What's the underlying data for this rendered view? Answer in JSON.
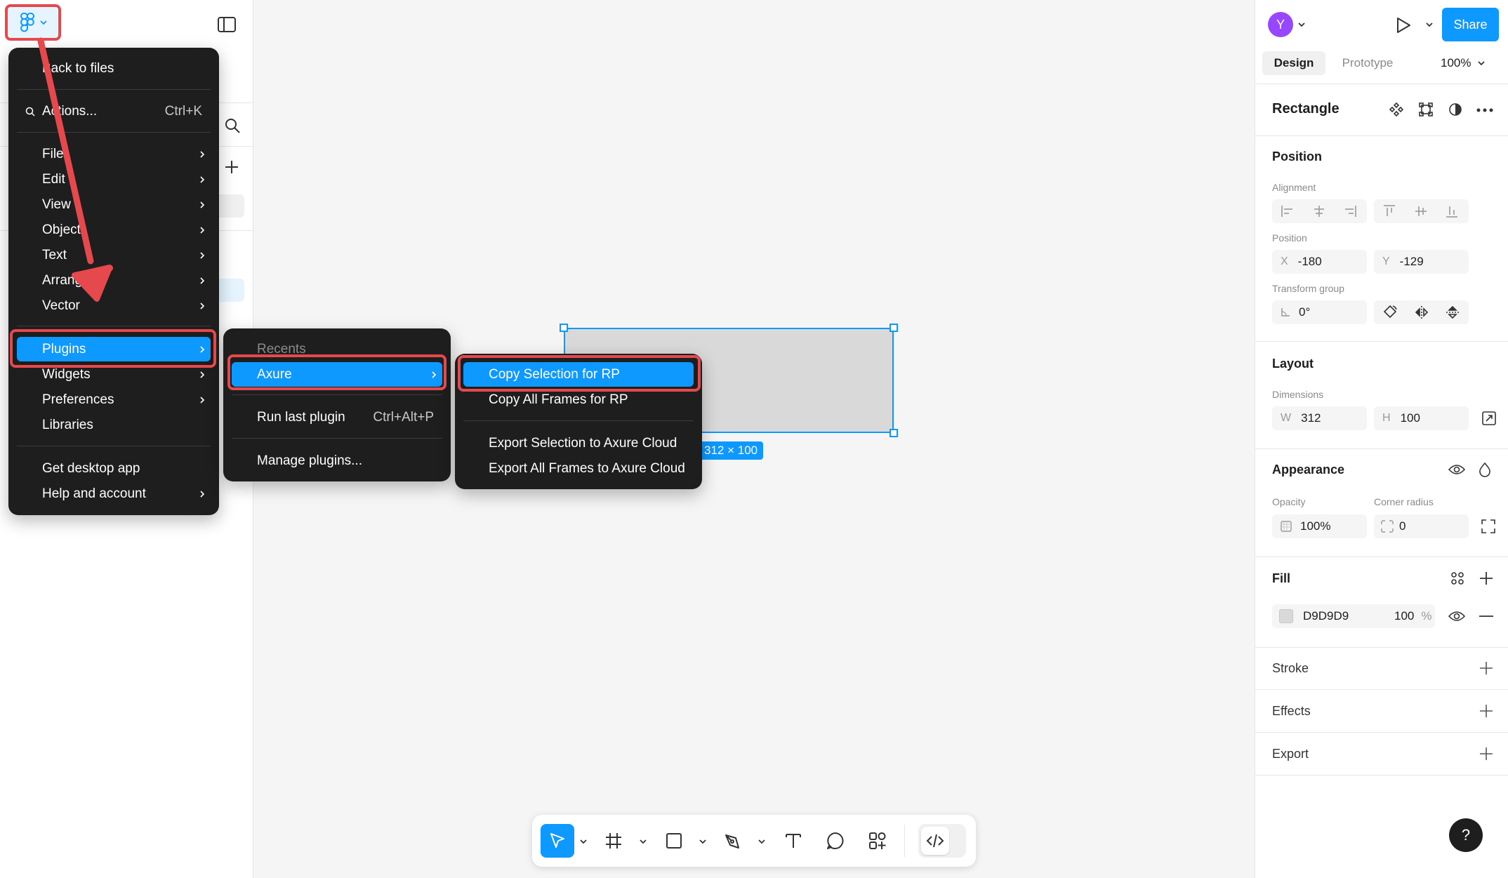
{
  "main_menu": {
    "back": "Back to files",
    "actions": "Actions...",
    "actions_shortcut": "Ctrl+K",
    "items": [
      "File",
      "Edit",
      "View",
      "Object",
      "Text",
      "Arrange",
      "Vector"
    ],
    "plugins": "Plugins",
    "items2": [
      "Widgets",
      "Preferences",
      "Libraries"
    ],
    "desktop": "Get desktop app",
    "help": "Help and account"
  },
  "plugins_menu": {
    "recents": "Recents",
    "axure": "Axure",
    "run_last": "Run last plugin",
    "run_last_shortcut": "Ctrl+Alt+P",
    "manage": "Manage plugins..."
  },
  "axure_menu": {
    "items": [
      "Copy Selection for RP",
      "Copy All Frames for RP",
      "Export Selection to Axure Cloud",
      "Export All Frames to Axure Cloud"
    ]
  },
  "canvas": {
    "size_label": "312 × 100"
  },
  "header": {
    "avatar_initial": "Y",
    "share": "Share",
    "tab_design": "Design",
    "tab_prototype": "Prototype",
    "zoom": "100%"
  },
  "inspector": {
    "layer_name": "Rectangle",
    "position": {
      "title": "Position",
      "alignment_label": "Alignment",
      "position_label": "Position",
      "x_key": "X",
      "x": "-180",
      "y_key": "Y",
      "y": "-129",
      "transform_label": "Transform group",
      "rotation": "0°"
    },
    "layout": {
      "title": "Layout",
      "dimensions_label": "Dimensions",
      "w_key": "W",
      "w": "312",
      "h_key": "H",
      "h": "100"
    },
    "appearance": {
      "title": "Appearance",
      "opacity_label": "Opacity",
      "opacity": "100%",
      "radius_label": "Corner radius",
      "radius": "0"
    },
    "fill": {
      "title": "Fill",
      "hex": "D9D9D9",
      "opacity": "100",
      "unit": "%"
    },
    "stroke": {
      "title": "Stroke"
    },
    "effects": {
      "title": "Effects"
    },
    "export": {
      "title": "Export"
    }
  },
  "help_button": "?",
  "colors": {
    "accent": "#0d99ff",
    "menu_bg": "#1e1e1e",
    "highlight": "#e5484d",
    "fill_swatch": "#D9D9D9"
  }
}
